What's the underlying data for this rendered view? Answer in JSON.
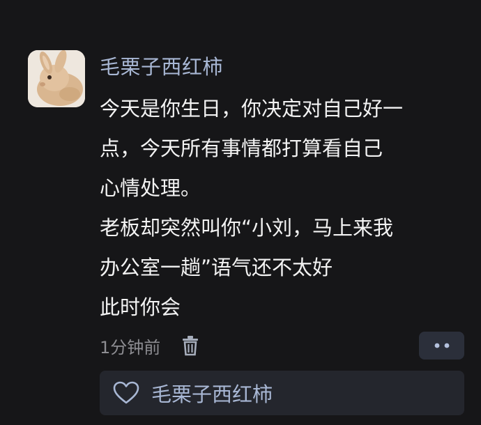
{
  "post": {
    "author": "毛栗子西红柿",
    "content_lines": [
      "今天是你生日，你决定对自己好一",
      "点，今天所有事情都打算看自己",
      "心情处理。",
      "老板却突然叫你“小刘，马上来我",
      "办公室一趟”语气还不太好",
      "此时你会"
    ],
    "timestamp": "1分钟前"
  },
  "likes": {
    "names": "毛栗子西红柿"
  },
  "icons": {
    "avatar": "bunny-photo",
    "delete": "trash-icon",
    "more": "more-dots-icon",
    "like": "heart-outline-icon"
  },
  "colors": {
    "background": "#161618",
    "username": "#a8b7d4",
    "text": "#f3f3f3",
    "meta": "#8d8d92",
    "panel": "#24262d"
  }
}
